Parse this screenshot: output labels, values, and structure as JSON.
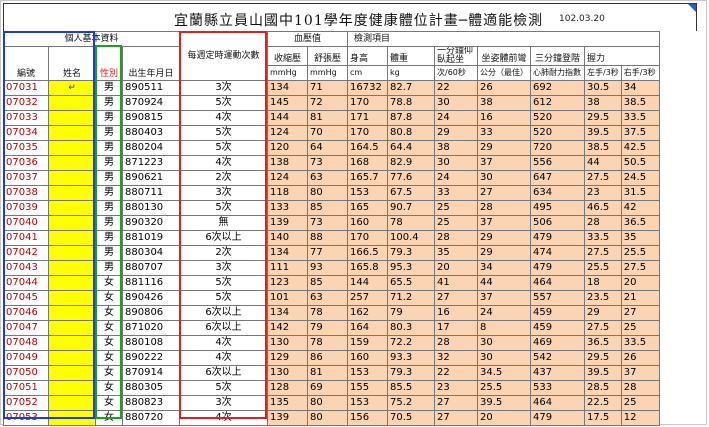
{
  "title": "宜蘭縣立員山國中101學年度健康體位計畫─體適能檢測",
  "date": "102.03.20",
  "header": {
    "group_basic": "個人基本資料",
    "group_bp": "血壓值",
    "group_test": "檢測項目",
    "col_id": "編號",
    "col_name": "姓名",
    "col_gender": "性別",
    "col_birth": "出生年月日",
    "col_exercise": "每週定時運動次數",
    "col_sys": "收縮壓",
    "col_dia": "舒張壓",
    "col_height": "身高",
    "col_weight": "體重",
    "col_situp": "一分鐘仰臥起坐",
    "col_sitreach": "坐姿體前彎",
    "col_step": "三分鐘登階",
    "col_grip": "握力",
    "unit_sys": "mmHg",
    "unit_dia": "mmHg",
    "unit_height": "cm",
    "unit_weight": "kg",
    "unit_situp": "次/60秒",
    "unit_sitreach": "公分（最佳）",
    "unit_step": "心肺耐力指數",
    "unit_grip_l": "左手/3秒",
    "unit_grip_r": "右手/3秒"
  },
  "cursor_glyph": "↵",
  "colors": {
    "peach": "#fbd4b4",
    "yellow": "#ffff00",
    "red": "#e02020",
    "blue": "#1d3bd8",
    "green": "#1aa01a",
    "id_red": "#c00000"
  },
  "rows": [
    {
      "id": "07031",
      "gender": "男",
      "birth": "890511",
      "ex": "3次",
      "sys": "134",
      "dia": "71",
      "h": "16732",
      "w": "82.7",
      "sit": "22",
      "reach": "26",
      "step": "692",
      "gl": "30.5",
      "gr": "34"
    },
    {
      "id": "07032",
      "gender": "男",
      "birth": "870924",
      "ex": "5次",
      "sys": "145",
      "dia": "72",
      "h": "170",
      "w": "78.8",
      "sit": "30",
      "reach": "38",
      "step": "612",
      "gl": "38",
      "gr": "38.5"
    },
    {
      "id": "07033",
      "gender": "男",
      "birth": "890815",
      "ex": "4次",
      "sys": "144",
      "dia": "81",
      "h": "171",
      "w": "87.8",
      "sit": "24",
      "reach": "16",
      "step": "520",
      "gl": "29.5",
      "gr": "33.5"
    },
    {
      "id": "07034",
      "gender": "男",
      "birth": "880403",
      "ex": "5次",
      "sys": "124",
      "dia": "70",
      "h": "170",
      "w": "80.8",
      "sit": "29",
      "reach": "33",
      "step": "520",
      "gl": "39.5",
      "gr": "37.5"
    },
    {
      "id": "07035",
      "gender": "男",
      "birth": "880204",
      "ex": "5次",
      "sys": "120",
      "dia": "64",
      "h": "164.5",
      "w": "64.4",
      "sit": "38",
      "reach": "29",
      "step": "720",
      "gl": "38.5",
      "gr": "42.5"
    },
    {
      "id": "07036",
      "gender": "男",
      "birth": "871223",
      "ex": "4次",
      "sys": "138",
      "dia": "73",
      "h": "168",
      "w": "82.9",
      "sit": "30",
      "reach": "37",
      "step": "556",
      "gl": "44",
      "gr": "50.5"
    },
    {
      "id": "07037",
      "gender": "男",
      "birth": "890621",
      "ex": "2次",
      "sys": "124",
      "dia": "63",
      "h": "165.7",
      "w": "77.6",
      "sit": "24",
      "reach": "30",
      "step": "647",
      "gl": "27.5",
      "gr": "24.5"
    },
    {
      "id": "07038",
      "gender": "男",
      "birth": "880711",
      "ex": "3次",
      "sys": "118",
      "dia": "80",
      "h": "153",
      "w": "67.5",
      "sit": "33",
      "reach": "27",
      "step": "634",
      "gl": "23",
      "gr": "31.5"
    },
    {
      "id": "07039",
      "gender": "男",
      "birth": "880130",
      "ex": "5次",
      "sys": "133",
      "dia": "85",
      "h": "165",
      "w": "90.7",
      "sit": "25",
      "reach": "28",
      "step": "495",
      "gl": "46.5",
      "gr": "42"
    },
    {
      "id": "07040",
      "gender": "男",
      "birth": "890320",
      "ex": "無",
      "sys": "139",
      "dia": "73",
      "h": "160",
      "w": "78",
      "sit": "25",
      "reach": "37",
      "step": "506",
      "gl": "28",
      "gr": "36.5"
    },
    {
      "id": "07041",
      "gender": "男",
      "birth": "881019",
      "ex": "6次以上",
      "sys": "140",
      "dia": "88",
      "h": "170",
      "w": "100.4",
      "sit": "28",
      "reach": "29",
      "step": "479",
      "gl": "33.5",
      "gr": "35"
    },
    {
      "id": "07042",
      "gender": "男",
      "birth": "880304",
      "ex": "2次",
      "sys": "134",
      "dia": "77",
      "h": "166.5",
      "w": "79.3",
      "sit": "35",
      "reach": "29",
      "step": "474",
      "gl": "27.5",
      "gr": "25.5"
    },
    {
      "id": "07043",
      "gender": "男",
      "birth": "880707",
      "ex": "3次",
      "sys": "111",
      "dia": "93",
      "h": "165.8",
      "w": "95.3",
      "sit": "20",
      "reach": "34",
      "step": "479",
      "gl": "25.5",
      "gr": "27.5"
    },
    {
      "id": "07044",
      "gender": "女",
      "birth": "881116",
      "ex": "5次",
      "sys": "123",
      "dia": "85",
      "h": "144",
      "w": "65.5",
      "sit": "41",
      "reach": "44",
      "step": "464",
      "gl": "18",
      "gr": "20"
    },
    {
      "id": "07045",
      "gender": "女",
      "birth": "890426",
      "ex": "5次",
      "sys": "101",
      "dia": "63",
      "h": "257",
      "w": "71.2",
      "sit": "27",
      "reach": "37",
      "step": "557",
      "gl": "23.5",
      "gr": "21"
    },
    {
      "id": "07046",
      "gender": "女",
      "birth": "890806",
      "ex": "6次以上",
      "sys": "134",
      "dia": "78",
      "h": "162",
      "w": "79",
      "sit": "16",
      "reach": "24",
      "step": "459",
      "gl": "29",
      "gr": "27"
    },
    {
      "id": "07047",
      "gender": "女",
      "birth": "871020",
      "ex": "6次以上",
      "sys": "142",
      "dia": "79",
      "h": "164",
      "w": "80.3",
      "sit": "17",
      "reach": "8",
      "step": "459",
      "gl": "27.5",
      "gr": "25"
    },
    {
      "id": "07048",
      "gender": "女",
      "birth": "880108",
      "ex": "4次",
      "sys": "130",
      "dia": "78",
      "h": "159",
      "w": "72.2",
      "sit": "28",
      "reach": "30",
      "step": "469",
      "gl": "36.5",
      "gr": "33.5"
    },
    {
      "id": "07049",
      "gender": "女",
      "birth": "890222",
      "ex": "4次",
      "sys": "129",
      "dia": "86",
      "h": "160",
      "w": "93.3",
      "sit": "32",
      "reach": "30",
      "step": "542",
      "gl": "29.5",
      "gr": "26"
    },
    {
      "id": "07050",
      "gender": "女",
      "birth": "870914",
      "ex": "6次以上",
      "sys": "130",
      "dia": "81",
      "h": "153",
      "w": "79.3",
      "sit": "22",
      "reach": "34.5",
      "step": "437",
      "gl": "39.5",
      "gr": "37"
    },
    {
      "id": "07051",
      "gender": "女",
      "birth": "880305",
      "ex": "5次",
      "sys": "128",
      "dia": "69",
      "h": "155",
      "w": "85.5",
      "sit": "23",
      "reach": "25.5",
      "step": "533",
      "gl": "28.5",
      "gr": "28"
    },
    {
      "id": "07052",
      "gender": "女",
      "birth": "880823",
      "ex": "3次",
      "sys": "135",
      "dia": "80",
      "h": "153",
      "w": "75.2",
      "sit": "27",
      "reach": "39.5",
      "step": "464",
      "gl": "22.5",
      "gr": "25"
    },
    {
      "id": "07053",
      "gender": "女",
      "birth": "880720",
      "ex": "4次",
      "sys": "139",
      "dia": "80",
      "h": "156",
      "w": "70.5",
      "sit": "27",
      "reach": "20",
      "step": "479",
      "gl": "17.5",
      "gr": "12"
    }
  ]
}
